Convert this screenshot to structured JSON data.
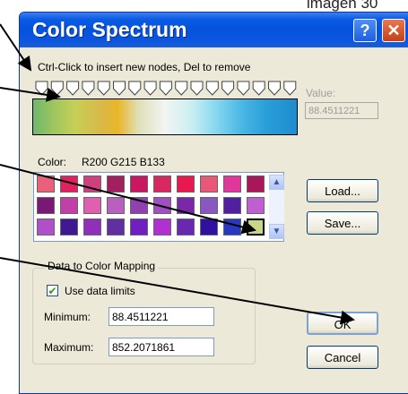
{
  "caption": "imagen 30",
  "window": {
    "title": "Color Spectrum",
    "help_glyph": "?",
    "close_glyph": "✕"
  },
  "spectrum": {
    "hint": "Ctrl-Click to insert new nodes, Del to remove",
    "node_count": 17,
    "value_label": "Value:",
    "value": "88.4511221"
  },
  "color": {
    "label": "Color:",
    "value": "R200 G215 B133",
    "swatches": [
      [
        "#e8607a",
        "#e02060",
        "#d04080",
        "#a02060",
        "#c81860",
        "#d82860",
        "#e81850",
        "#e85878",
        "#e0389a",
        "#a81858"
      ],
      [
        "#7a1878",
        "#c040a8",
        "#e060b0",
        "#b860c0",
        "#9040b0",
        "#a050c0",
        "#7828a8",
        "#8858c0",
        "#5020a0",
        "#c060d0"
      ],
      [
        "#b050c8",
        "#401890",
        "#9030b8",
        "#6030a0",
        "#7020c0",
        "#b030d0",
        "#6828b0",
        "#3010a0",
        "#2838c0",
        "#c8d785"
      ]
    ],
    "selected_index": [
      2,
      9
    ]
  },
  "buttons": {
    "load": "Load...",
    "save": "Save...",
    "ok": "OK",
    "cancel": "Cancel"
  },
  "mapping": {
    "title": "Data to Color Mapping",
    "use_limits_label": "Use data limits",
    "use_limits_checked": true,
    "checkmark": "✔",
    "min_label": "Minimum:",
    "min_value": "88.4511221",
    "max_label": "Maximum:",
    "max_value": "852.2071861"
  },
  "scroll": {
    "up": "▲",
    "down": "▼"
  },
  "colors": {
    "title_bar": "#0553dc",
    "dialog_bg": "#ece9d8"
  }
}
